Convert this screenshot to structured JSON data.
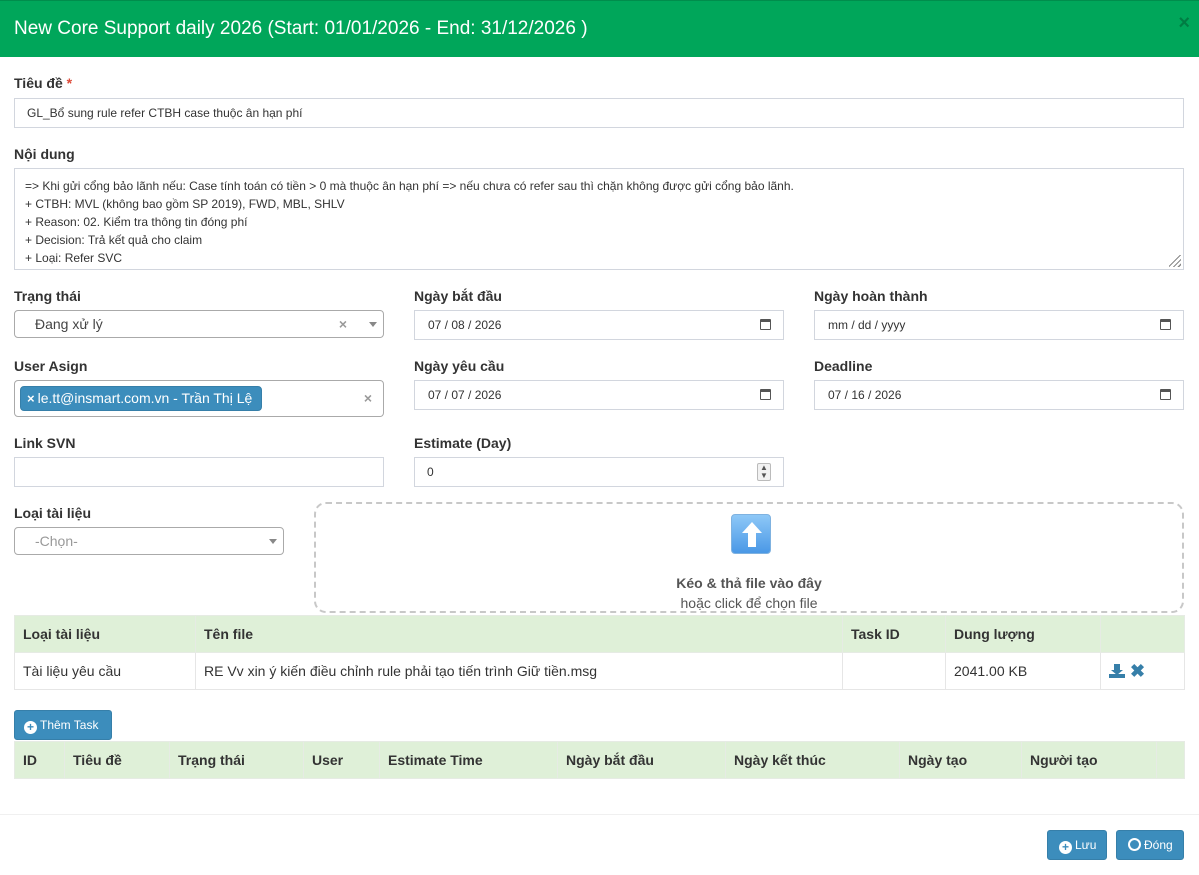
{
  "header": {
    "title": "New Core Support daily 2026 (Start: 01/01/2026 - End: 31/12/2026 )",
    "close_glyph": "×",
    "close_icon": "close-icon",
    "color": "#00a65a"
  },
  "form": {
    "title_label": "Tiêu đề",
    "required_mark": "*",
    "title_value": "GL_Bổ sung rule refer CTBH case thuộc ân hạn phí",
    "content_label": "Nội dung",
    "content_lines": [
      "=> Khi gửi cổng bảo lãnh nếu: Case tính toán có tiền > 0 mà thuộc ân hạn phí => nếu chưa có refer sau thì chặn không được gửi cổng bảo lãnh.",
      "+ CTBH: MVL (không bao gồm SP 2019), FWD, MBL, SHLV",
      "+ Reason: 02. Kiểm tra thông tin đóng phí",
      "+ Decision: Trả kết quả cho claim",
      "+ Loại: Refer SVC"
    ],
    "status_label": "Trạng thái",
    "status_value": "Đang xử lý",
    "start_date_label": "Ngày bắt đầu",
    "start_date_value": "07 / 08 / 2026",
    "complete_date_label": "Ngày hoàn thành",
    "complete_date_placeholder": "mm / dd / yyyy",
    "user_assign_label": "User Asign",
    "user_assign_chip": "le.tt@insmart.com.vn - Trần Thị Lệ",
    "request_date_label": "Ngày yêu cầu",
    "request_date_value": "07 / 07 / 2026",
    "deadline_label": "Deadline",
    "deadline_value": "07 / 16 / 2026",
    "link_svn_label": "Link SVN",
    "link_svn_value": "",
    "estimate_label": "Estimate (Day)",
    "estimate_value": "0",
    "doc_type_label": "Loại tài liệu",
    "doc_type_value": "-Chọn-"
  },
  "dropzone": {
    "title": "Kéo & thả file vào đây",
    "subtitle": "hoặc click để chọn file",
    "icon": "upload-arrow-icon"
  },
  "files_table": {
    "headers": [
      "Loại tài liệu",
      "Tên file",
      "Task ID",
      "Dung lượng",
      ""
    ],
    "rows": [
      {
        "doc_type": "Tài liệu yêu cầu",
        "file_name": "RE Vv xin ý kiến điều chỉnh rule phải tạo tiến trình Giữ tiền.msg",
        "task_id": "",
        "size": "2041.00 KB"
      }
    ]
  },
  "add_task_button": "Thêm Task",
  "tasks_table": {
    "headers": [
      "ID",
      "Tiêu đề",
      "Trạng thái",
      "User",
      "Estimate Time",
      "Ngày bắt đầu",
      "Ngày kết thúc",
      "Ngày tạo",
      "Người tạo",
      ""
    ]
  },
  "footer": {
    "save_label": "Lưu",
    "close_label": "Đóng",
    "accent": "#3c8dbc"
  }
}
